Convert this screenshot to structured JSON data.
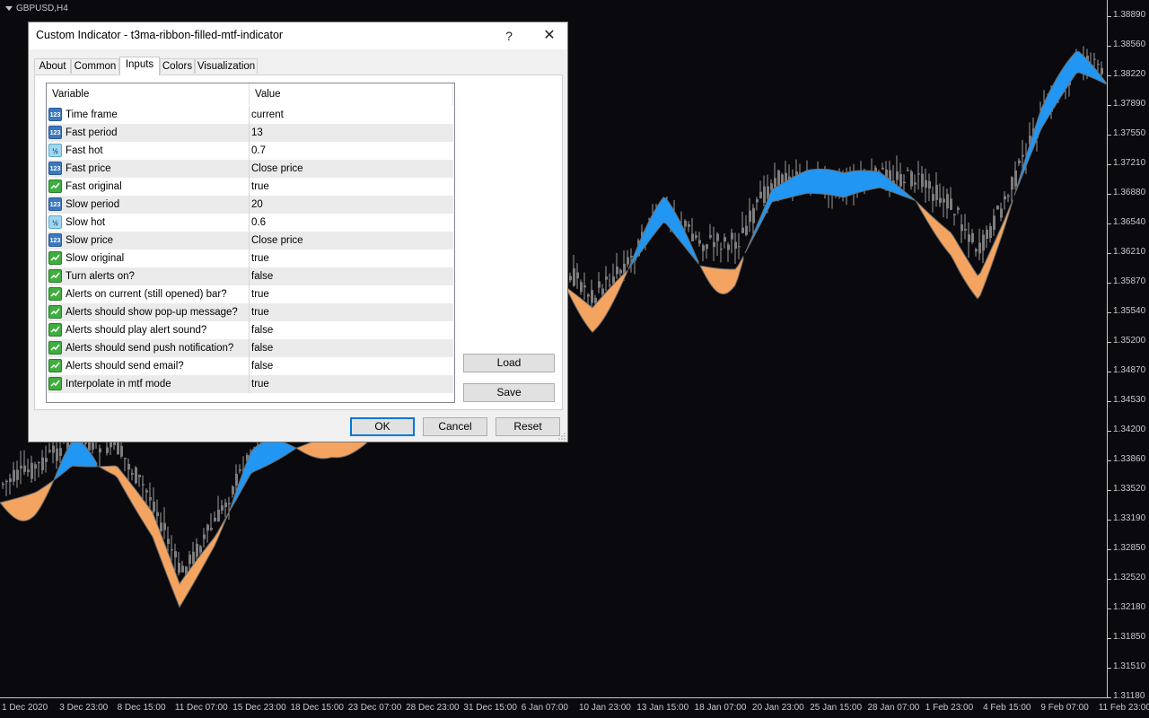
{
  "chart": {
    "symbol": "GBPUSD,H4",
    "price_labels": [
      "1.38890",
      "1.38560",
      "1.38220",
      "1.37890",
      "1.37550",
      "1.37210",
      "1.36880",
      "1.36540",
      "1.36210",
      "1.35870",
      "1.35540",
      "1.35200",
      "1.34870",
      "1.34530",
      "1.34200",
      "1.33860",
      "1.33520",
      "1.33190",
      "1.32850",
      "1.32520",
      "1.32180",
      "1.31850",
      "1.31510",
      "1.31180"
    ],
    "time_labels": [
      "1 Dec 2020",
      "3 Dec 23:00",
      "8 Dec 15:00",
      "11 Dec 07:00",
      "15 Dec 23:00",
      "18 Dec 15:00",
      "23 Dec 07:00",
      "28 Dec 23:00",
      "31 Dec 15:00",
      "6 Jan 07:00",
      "10 Jan 23:00",
      "13 Jan 15:00",
      "18 Jan 07:00",
      "20 Jan 23:00",
      "25 Jan 15:00",
      "28 Jan 07:00",
      "1 Feb 23:00",
      "4 Feb 15:00",
      "9 Feb 07:00",
      "11 Feb 23:00"
    ],
    "colors": {
      "background": "#0a0a0e",
      "candle": "#8a8a8a",
      "ribbon_up": "#2196f3",
      "ribbon_down": "#f4a460"
    }
  },
  "dialog": {
    "title": "Custom Indicator - t3ma-ribbon-filled-mtf-indicator",
    "help_label": "?",
    "close_label": "✕",
    "tabs": [
      {
        "label": "About"
      },
      {
        "label": "Common"
      },
      {
        "label": "Inputs"
      },
      {
        "label": "Colors"
      },
      {
        "label": "Visualization"
      }
    ],
    "active_tab": "Inputs",
    "grid": {
      "col_variable": "Variable",
      "col_value": "Value",
      "rows": [
        {
          "icon": "int",
          "variable": "Time frame",
          "value": "current"
        },
        {
          "icon": "int",
          "variable": "Fast period",
          "value": "13"
        },
        {
          "icon": "dbl",
          "variable": "Fast hot",
          "value": "0.7"
        },
        {
          "icon": "int",
          "variable": "Fast price",
          "value": "Close price"
        },
        {
          "icon": "bool",
          "variable": "Fast original",
          "value": "true"
        },
        {
          "icon": "int",
          "variable": "Slow period",
          "value": "20"
        },
        {
          "icon": "dbl",
          "variable": "Slow hot",
          "value": "0.6"
        },
        {
          "icon": "int",
          "variable": "Slow price",
          "value": "Close price"
        },
        {
          "icon": "bool",
          "variable": "Slow original",
          "value": "true"
        },
        {
          "icon": "bool",
          "variable": "Turn alerts on?",
          "value": "false"
        },
        {
          "icon": "bool",
          "variable": "Alerts on current (still opened) bar?",
          "value": "true"
        },
        {
          "icon": "bool",
          "variable": "Alerts should show pop-up message?",
          "value": "true"
        },
        {
          "icon": "bool",
          "variable": "Alerts should play alert sound?",
          "value": "false"
        },
        {
          "icon": "bool",
          "variable": "Alerts should send push notification?",
          "value": "false"
        },
        {
          "icon": "bool",
          "variable": "Alerts should send email?",
          "value": "false"
        },
        {
          "icon": "bool",
          "variable": "Interpolate in mtf mode",
          "value": "true"
        }
      ]
    },
    "load_label": "Load",
    "save_label": "Save",
    "ok_label": "OK",
    "cancel_label": "Cancel",
    "reset_label": "Reset"
  }
}
